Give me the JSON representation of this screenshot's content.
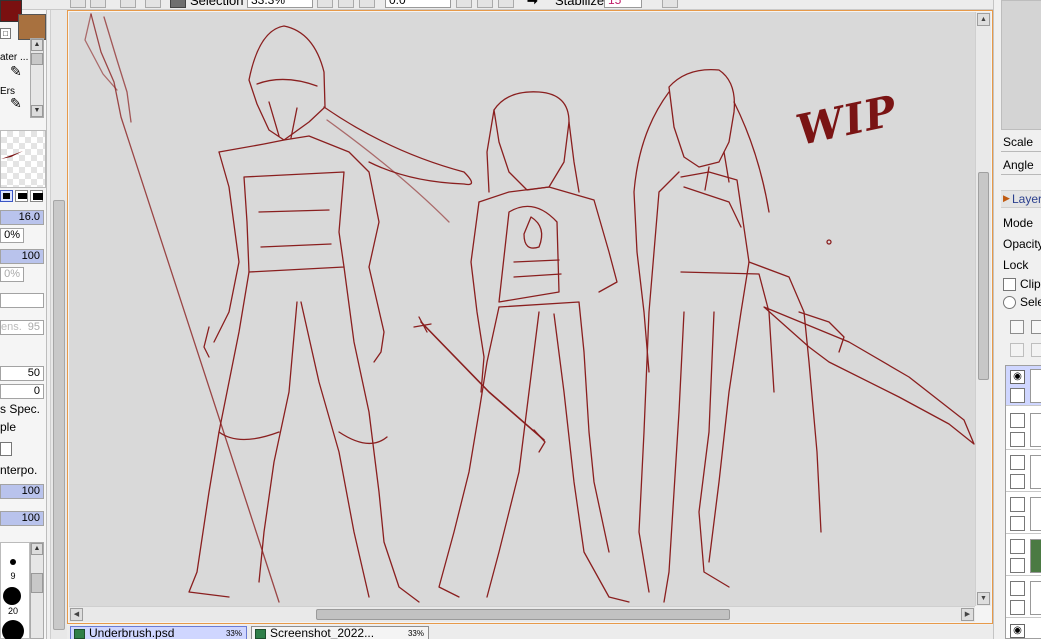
{
  "toolbar": {
    "selection_label": "Selection",
    "zoom_value": "33.3%",
    "rotation_value": "0.0",
    "stabilizer_label": "Stabilizer",
    "stabilizer_value": "15"
  },
  "tools": {
    "tool_name_1": "ater ...",
    "tool_name_2": "Ers",
    "brush_size": "16.0",
    "min_size_pct": "0%",
    "density": "100",
    "min_density_pct": "0%",
    "dens_label": "ens.",
    "dens_value": "95",
    "blending": "50",
    "dilution": "0",
    "adv_spec_label": "s Spec.",
    "sample_label": "ple",
    "interpo_label": "nterpo.",
    "value_1": "100",
    "value_2": "100",
    "brush_sizes": [
      "9",
      "20"
    ]
  },
  "canvas": {
    "annotation": "WIP"
  },
  "doc_tabs": [
    {
      "name": "Underbrush.psd",
      "zoom": "33%",
      "active": true
    },
    {
      "name": "Screenshot_2022...",
      "zoom": "33%",
      "active": false
    }
  ],
  "navigator": {
    "scale_label": "Scale",
    "angle_label": "Angle"
  },
  "layer_panel": {
    "header": "Layer",
    "mode_label": "Mode",
    "opacity_label": "Opacity",
    "lock_label": "Lock",
    "clipping_label": "Clipp",
    "selection_source_label": "Sele"
  },
  "colors": {
    "primary": "#7a1010",
    "secondary": "#a8713f",
    "sketch": "#8a1f1f",
    "canvas_bg": "#d9d9d9",
    "selection_accent": "#cfd6ff"
  }
}
